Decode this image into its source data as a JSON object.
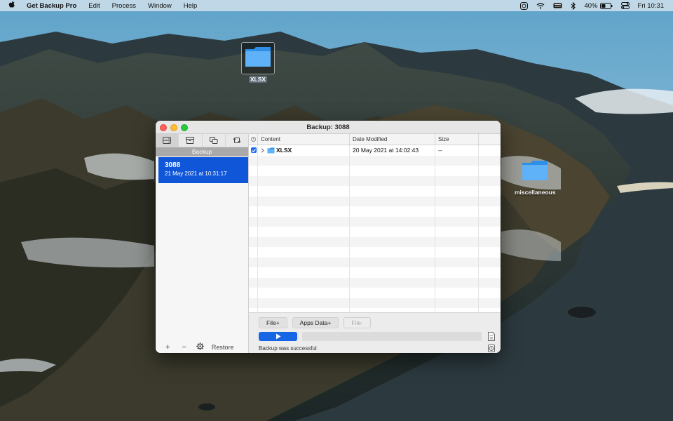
{
  "menubar": {
    "app_name": "Get Backup Pro",
    "menus": [
      "Edit",
      "Process",
      "Window",
      "Help"
    ],
    "battery": "40%",
    "clock": "Fri 10:31"
  },
  "desktop": {
    "icons": [
      {
        "label": "XLSX",
        "selected": true
      },
      {
        "label": "miscellaneous",
        "selected": false
      }
    ]
  },
  "window": {
    "title": "Backup: 3088",
    "sidebar": {
      "section_header": "Backup",
      "items": [
        {
          "name": "3088",
          "date": "21 May 2021 at 10:31:17",
          "selected": true
        }
      ],
      "bottom": {
        "add": "+",
        "remove": "−",
        "restore": "Restore"
      }
    },
    "table": {
      "columns": [
        "Content",
        "Date Modified",
        "Size"
      ],
      "rows": [
        {
          "checked": true,
          "name": "XLSX",
          "date": "20 May 2021 at 14:02:43",
          "size": "--"
        }
      ]
    },
    "buttons": {
      "file_plus": "File+",
      "apps_data_plus": "Apps Data+",
      "file_minus": "File-"
    },
    "status": "Backup was successful"
  }
}
